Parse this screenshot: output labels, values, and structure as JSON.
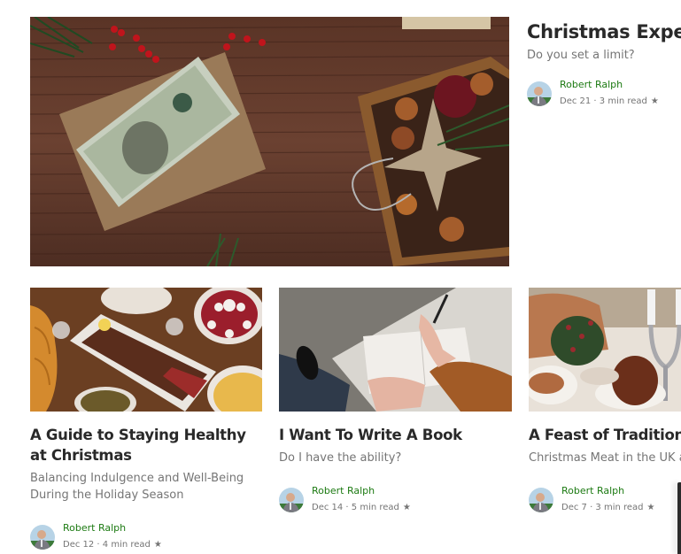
{
  "featured": {
    "title": "Christmas Expectations",
    "subtitle": "Do you set a limit?",
    "image": "christmas-money-envelope-photo",
    "author": "Robert Ralph",
    "date": "Dec 21",
    "read_time": "3 min read",
    "meta": "Dec 21 · 3 min read",
    "star_icon": "star-icon"
  },
  "cards": [
    {
      "title": "A Guide to Staying Healthy at Christmas",
      "subtitle": "Balancing Indulgence and Well-Being During the Holiday Season",
      "image": "christmas-feast-photo",
      "author": "Robert Ralph",
      "meta": "Dec 12 · 4 min read"
    },
    {
      "title": "I Want To Write A Book",
      "subtitle": "Do I have the ability?",
      "image": "writing-notebook-photo",
      "author": "Robert Ralph",
      "meta": "Dec 14 · 5 min read"
    },
    {
      "title": "A Feast of Tradition",
      "subtitle": "Christmas Meat in the UK and",
      "image": "christmas-table-roast-photo",
      "author": "Robert Ralph",
      "meta": "Dec 7 · 3 min read"
    }
  ],
  "icons": {
    "star": "★"
  },
  "colors": {
    "author_green": "#1c7a12",
    "title": "#292929",
    "muted": "#757575"
  }
}
